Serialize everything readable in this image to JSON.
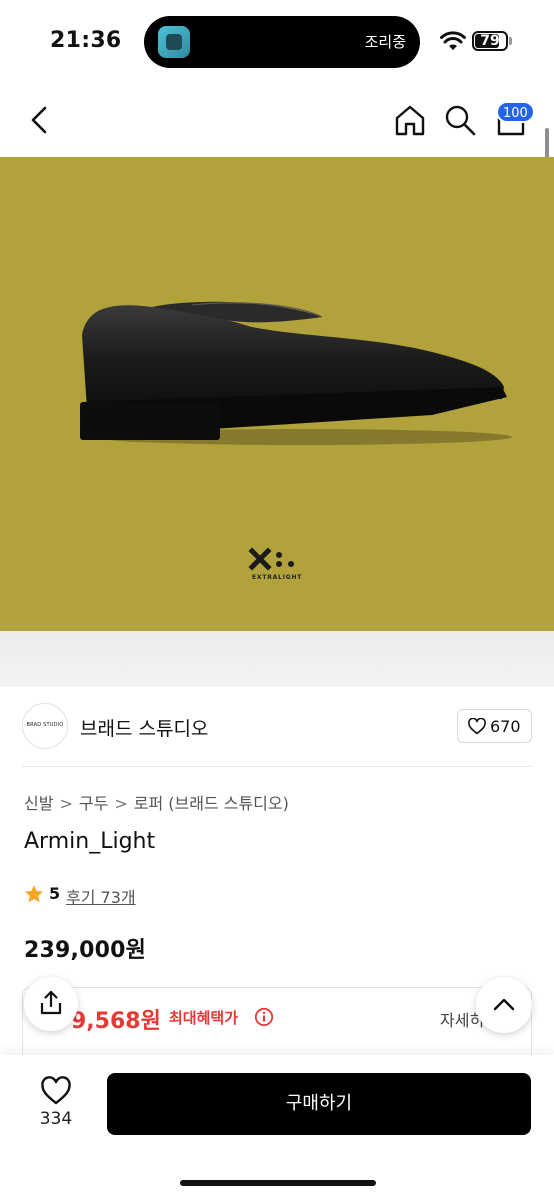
{
  "status_bar": {
    "time": "21:36",
    "activity_text": "조리중",
    "battery_level": "79",
    "battery_fraction": 0.79
  },
  "nav": {
    "back_icon": "chevron-left-icon",
    "home_icon": "home-icon",
    "search_icon": "search-icon",
    "cart_icon": "cart-icon",
    "cart_badge": "100",
    "accent_color": "#2463eb"
  },
  "hero": {
    "background_color": "#b1a23c",
    "logo_text": "EXTRALIGHT"
  },
  "brand": {
    "logo_text": "BRAD STUDIO",
    "name": "브래드 스튜디오",
    "like_count": "670"
  },
  "product": {
    "breadcrumb": [
      "신발",
      "구두",
      "로퍼 (브래드 스튜디오)"
    ],
    "breadcrumb_separator": ">",
    "title": "Armin_Light",
    "rating": "5",
    "review_link": "후기 73개",
    "price": "239,000원"
  },
  "benefit": {
    "price": "9,568원",
    "label": "최대혜택가",
    "detail": "자세히",
    "color": "#e53935"
  },
  "bottom_bar": {
    "wish_count": "334",
    "buy_label": "구매하기"
  }
}
